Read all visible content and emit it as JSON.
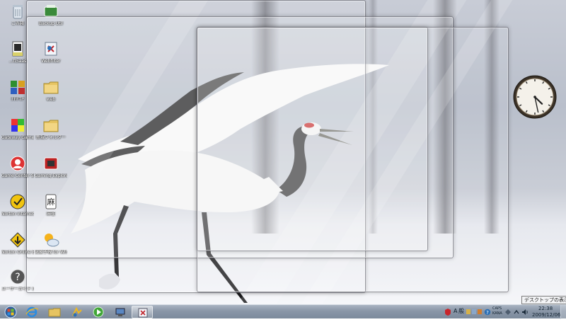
{
  "desktop": {
    "icons": [
      {
        "name": "recycle-bin-icon",
        "label": "ごみ箱"
      },
      {
        "name": "backup-util-icon",
        "label": "Backup Util"
      },
      {
        "name": "pdf-app-icon",
        "label": "...ftSaas"
      },
      {
        "name": "webfilter-icon",
        "label": "Webfilter"
      },
      {
        "name": "ffftp-icon",
        "label": "FFFTP"
      },
      {
        "name": "web-folder-icon",
        "label": "web"
      },
      {
        "name": "gateway-game-icon",
        "label": "Gateway Game Co..."
      },
      {
        "name": "folder-icon",
        "label": "新規フォルダー"
      },
      {
        "name": "game-center-icon",
        "label": "Game Center Start..."
      },
      {
        "name": "gaming-explorer-icon",
        "label": "Gaming Explorer"
      },
      {
        "name": "norton-security-icon",
        "label": "Norton Internet Security"
      },
      {
        "name": "mahjong-icon",
        "label": "麻雀"
      },
      {
        "name": "norton-backup-icon",
        "label": "Norton Online Backup"
      },
      {
        "name": "weather-icon",
        "label": "気象予報 for Windows"
      },
      {
        "name": "user-guide-icon",
        "label": "ユーザーガイド (Gateway ..."
      }
    ]
  },
  "clock": {
    "hour": 4,
    "minute": 28
  },
  "taskbar": {
    "items": [
      "start-orb",
      "ie-icon",
      "explorer-icon",
      "winamp-icon",
      "media-player-icon",
      "network-icon",
      "flash-app-icon"
    ],
    "tray": {
      "lang": "A",
      "ime": "般",
      "caps": "CAPS",
      "kana": "KANA",
      "time": "22:38",
      "date": "2009/12/06"
    },
    "tooltip": "デスクトップの表示"
  },
  "colors": {
    "taskbar": "#8996a7",
    "accent": "#2b6fb5"
  }
}
